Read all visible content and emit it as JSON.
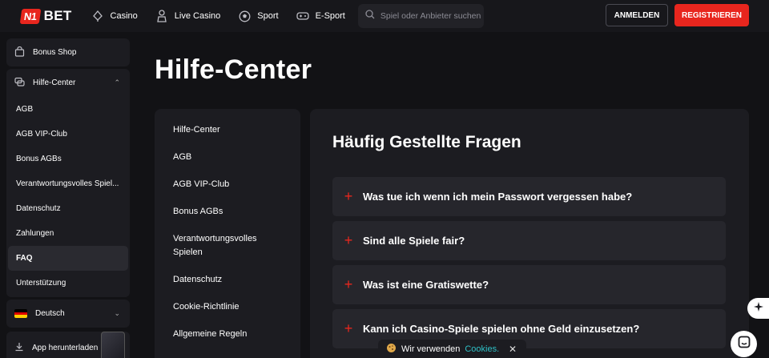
{
  "header": {
    "logo_mark": "N1",
    "logo_text": "BET",
    "nav": [
      {
        "label": "Casino",
        "icon": "casino-icon"
      },
      {
        "label": "Live Casino",
        "icon": "live-casino-icon"
      },
      {
        "label": "Sport",
        "icon": "sport-icon"
      },
      {
        "label": "E-Sport",
        "icon": "gamepad-icon"
      }
    ],
    "search_placeholder": "Spiel oder Anbieter suchen",
    "login_label": "ANMELDEN",
    "register_label": "REGISTRIEREN"
  },
  "sidebar": {
    "bonus_shop": "Bonus Shop",
    "help_center": "Hilfe-Center",
    "sub_items": [
      "AGB",
      "AGB VIP-Club",
      "Bonus AGBs",
      "Verantwortungsvolles Spiel...",
      "Datenschutz",
      "Zahlungen",
      "FAQ",
      "Unterstützung"
    ],
    "active_item": "FAQ",
    "language": "Deutsch",
    "app_download": "App herunterladen"
  },
  "main": {
    "page_title": "Hilfe-Center",
    "help_nav": [
      "Hilfe-Center",
      "AGB",
      "AGB VIP-Club",
      "Bonus AGBs",
      "Verantwortungsvolles Spielen",
      "Datenschutz",
      "Cookie-Richtlinie",
      "Allgemeine Regeln"
    ],
    "faq_title": "Häufig Gestellte Fragen",
    "faq_items": [
      "Was tue ich wenn ich mein Passwort vergessen habe?",
      "Sind alle Spiele fair?",
      "Was ist eine Gratiswette?",
      "Kann ich Casino-Spiele spielen ohne Geld einzusetzen?"
    ]
  },
  "cookie_banner": {
    "text": "Wir verwenden",
    "link": "Cookies."
  },
  "colors": {
    "accent": "#e8261e",
    "background": "#121215",
    "panel": "#1c1c21",
    "link": "#2fc0c6"
  }
}
